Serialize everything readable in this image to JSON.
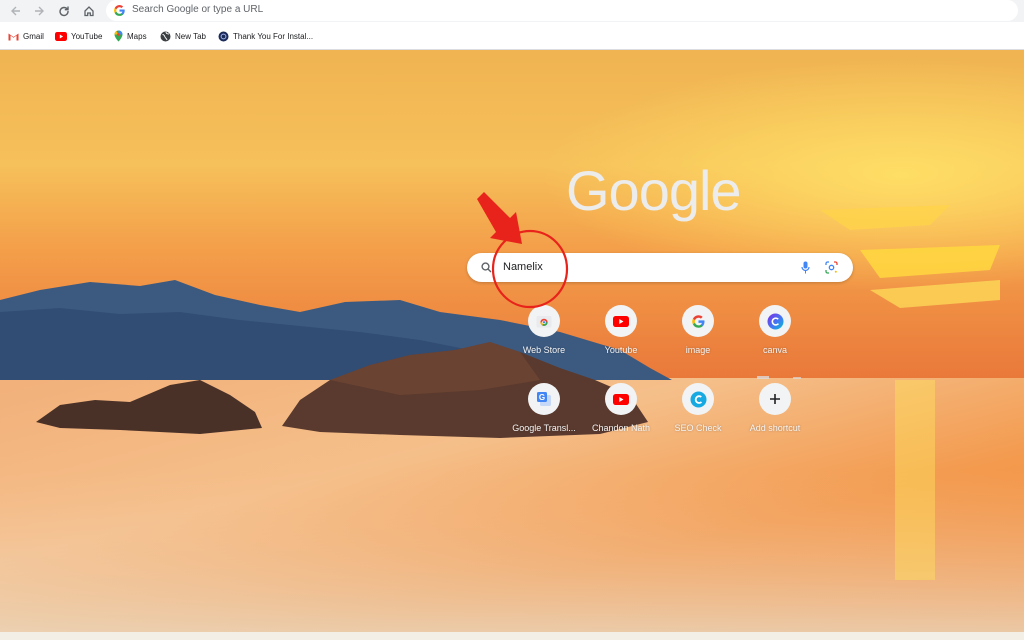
{
  "omnibox": {
    "placeholder": "Search Google or type a URL"
  },
  "bookmarks": [
    {
      "label": "Gmail",
      "icon": "gmail-icon"
    },
    {
      "label": "YouTube",
      "icon": "youtube-icon"
    },
    {
      "label": "Maps",
      "icon": "maps-icon"
    },
    {
      "label": "New Tab",
      "icon": "globe-icon"
    },
    {
      "label": "Thank You For Instal...",
      "icon": "site-icon"
    }
  ],
  "ntp": {
    "logo_text": "Google",
    "search_value": "Namelix"
  },
  "shortcuts": [
    {
      "label": "Web Store",
      "icon": "webstore-icon"
    },
    {
      "label": "Youtube",
      "icon": "youtube-icon"
    },
    {
      "label": "image",
      "icon": "google-icon"
    },
    {
      "label": "canva",
      "icon": "canva-icon"
    },
    {
      "label": "Google Transl...",
      "icon": "translate-icon"
    },
    {
      "label": "Chandon Nath",
      "icon": "youtube-icon"
    },
    {
      "label": "SEO Check",
      "icon": "seo-check-icon"
    },
    {
      "label": "Add shortcut",
      "icon": "plus-icon"
    }
  ],
  "colors": {
    "arrow_annotation": "#e8231b"
  }
}
